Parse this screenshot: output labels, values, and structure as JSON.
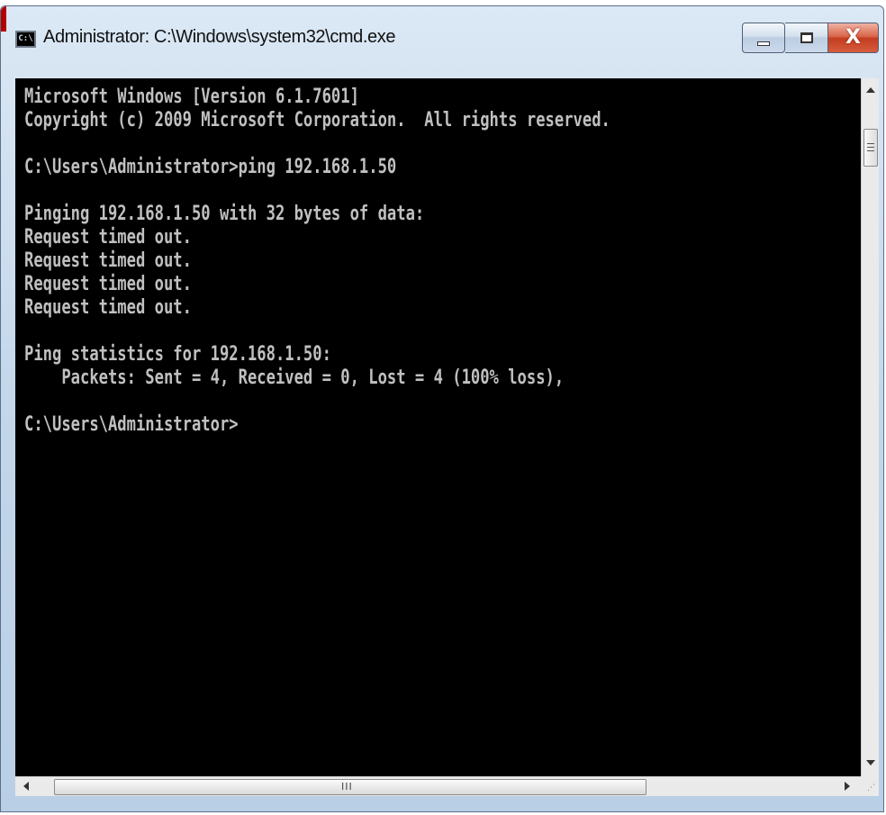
{
  "window": {
    "title": "Administrator: C:\\Windows\\system32\\cmd.exe",
    "app_icon_text": "C:\\",
    "buttons": {
      "minimize": "minimize",
      "maximize": "maximize",
      "close": "X"
    }
  },
  "console": {
    "lines": [
      "Microsoft Windows [Version 6.1.7601]",
      "Copyright (c) 2009 Microsoft Corporation.  All rights reserved.",
      "",
      "C:\\Users\\Administrator>ping 192.168.1.50",
      "",
      "Pinging 192.168.1.50 with 32 bytes of data:",
      "Request timed out.",
      "Request timed out.",
      "Request timed out.",
      "Request timed out.",
      "",
      "Ping statistics for 192.168.1.50:",
      "    Packets: Sent = 4, Received = 0, Lost = 4 (100% loss),",
      "",
      "C:\\Users\\Administrator>"
    ],
    "text_color": "#c0c0c0",
    "background_color": "#000000"
  },
  "scrollbars": {
    "horizontal_grip": "III"
  }
}
